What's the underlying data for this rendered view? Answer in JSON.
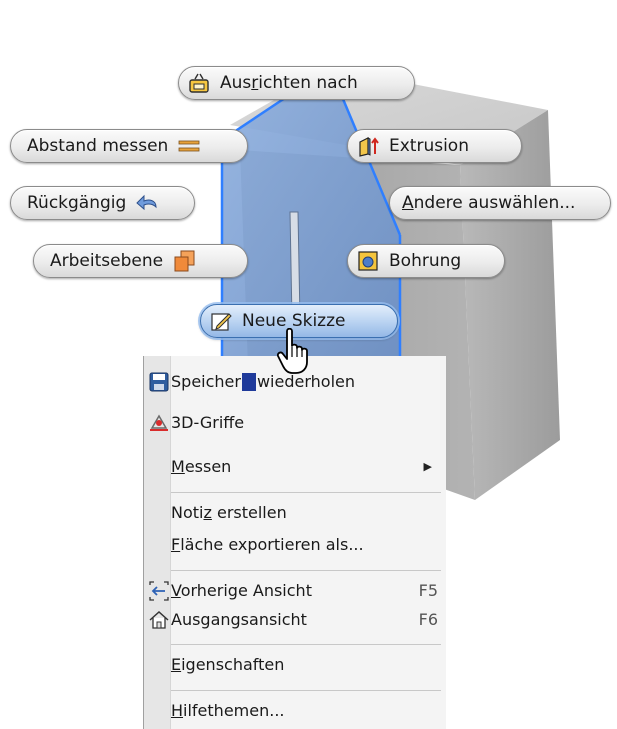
{
  "marking_menu": {
    "ausrichten": {
      "label_pre": "Aus",
      "label_ul": "r",
      "label_post": "ichten nach",
      "icon": "align-to-icon"
    },
    "abstand": {
      "label": "Abstand messen",
      "icon": "measure-distance-icon"
    },
    "extrusion": {
      "label": "Extrusion",
      "icon": "extrude-icon"
    },
    "rueckgaengig": {
      "label": "Rückgängig",
      "icon": "undo-icon"
    },
    "andere": {
      "label_ul": "A",
      "label_post": "ndere auswählen...",
      "icon": ""
    },
    "arbeitsebene": {
      "label": "Arbeitsebene",
      "icon": "work-plane-icon"
    },
    "bohrung": {
      "label": "Bohrung",
      "icon": "hole-icon"
    },
    "neue_skizze": {
      "label": "Neue Skizze",
      "icon": "new-sketch-icon"
    }
  },
  "context_menu": {
    "items": [
      {
        "pre": "Speicher",
        "ul": "",
        "post": "",
        "overlay": "wiederholen",
        "icon": "save-icon"
      },
      {
        "pre": "3D-Griffe",
        "ul": "",
        "post": "",
        "icon": "3d-grips-icon"
      },
      {
        "pre": "",
        "ul": "M",
        "post": "essen",
        "submenu": true
      },
      {
        "pre": "Noti",
        "ul": "z",
        "post": " erstellen"
      },
      {
        "pre": "",
        "ul": "F",
        "post": "läche exportieren als..."
      },
      {
        "pre": "",
        "ul": "V",
        "post": "orherige Ansicht",
        "shortcut": "F5",
        "icon": "previous-view-icon"
      },
      {
        "pre": "Ausgangsansicht",
        "ul": "",
        "post": "",
        "shortcut": "F6",
        "icon": "home-view-icon"
      },
      {
        "pre": "",
        "ul": "E",
        "post": "igenschaften"
      },
      {
        "pre": "",
        "ul": "H",
        "post": "ilfethemen..."
      }
    ]
  },
  "colors": {
    "model_gray": "#a9a9a9",
    "face_blue": "#6f93c8",
    "edge_blue": "#2f7fff",
    "menu_bg": "#f4f4f4",
    "pill_active": "#b8d2f1"
  }
}
